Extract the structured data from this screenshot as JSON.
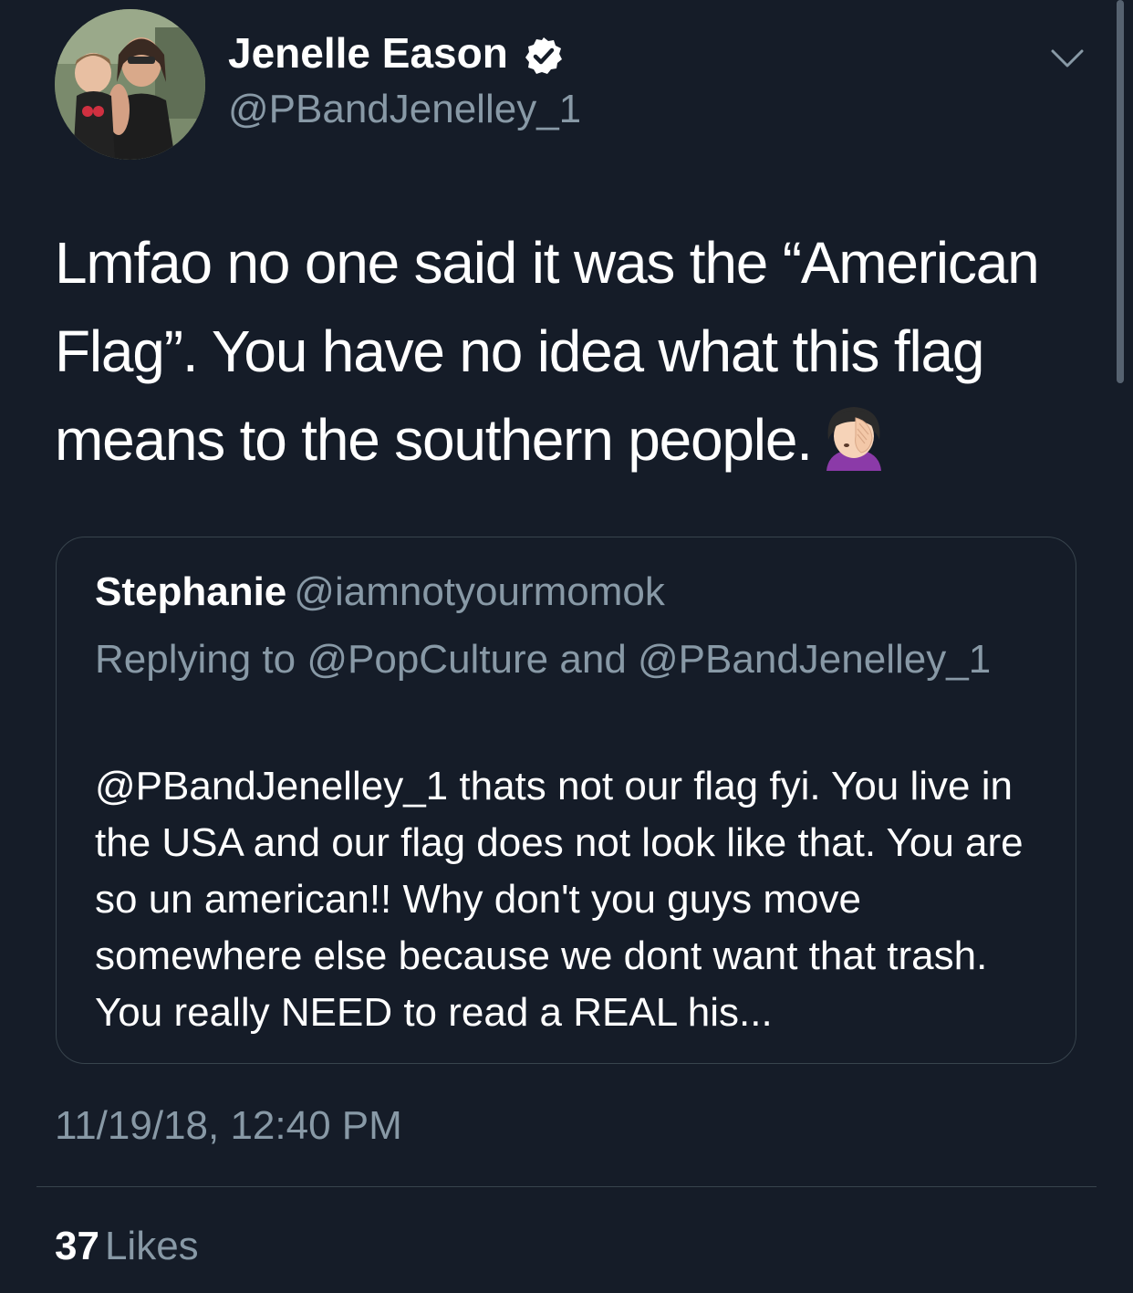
{
  "colors": {
    "background": "#151c28",
    "primary_text": "#ffffff",
    "secondary_text": "#8899a6",
    "border": "#38444d"
  },
  "tweet": {
    "author_name": "Jenelle Eason",
    "author_handle": "@PBandJenelley_1",
    "verified_icon": "verified-badge-icon",
    "menu_icon": "chevron-down-icon",
    "text": "Lmfao no one said it was the “American Flag”. You have no idea what this flag means to the southern people.",
    "emoji_icon": "face-palm-icon",
    "timestamp": "11/19/18, 12:40 PM",
    "likes_count": "37",
    "likes_label": "Likes"
  },
  "quoted_tweet": {
    "author_name": "Stephanie",
    "author_handle": "@iamnotyourmomok",
    "reply_context": "Replying to @PopCulture and @PBandJenelley_1",
    "text": "@PBandJenelley_1 thats not our flag fyi. You live in the USA and our flag does not look like that. You are so un american!! Why don't you guys move somewhere else because we dont want that trash. You really NEED to read a REAL his..."
  }
}
